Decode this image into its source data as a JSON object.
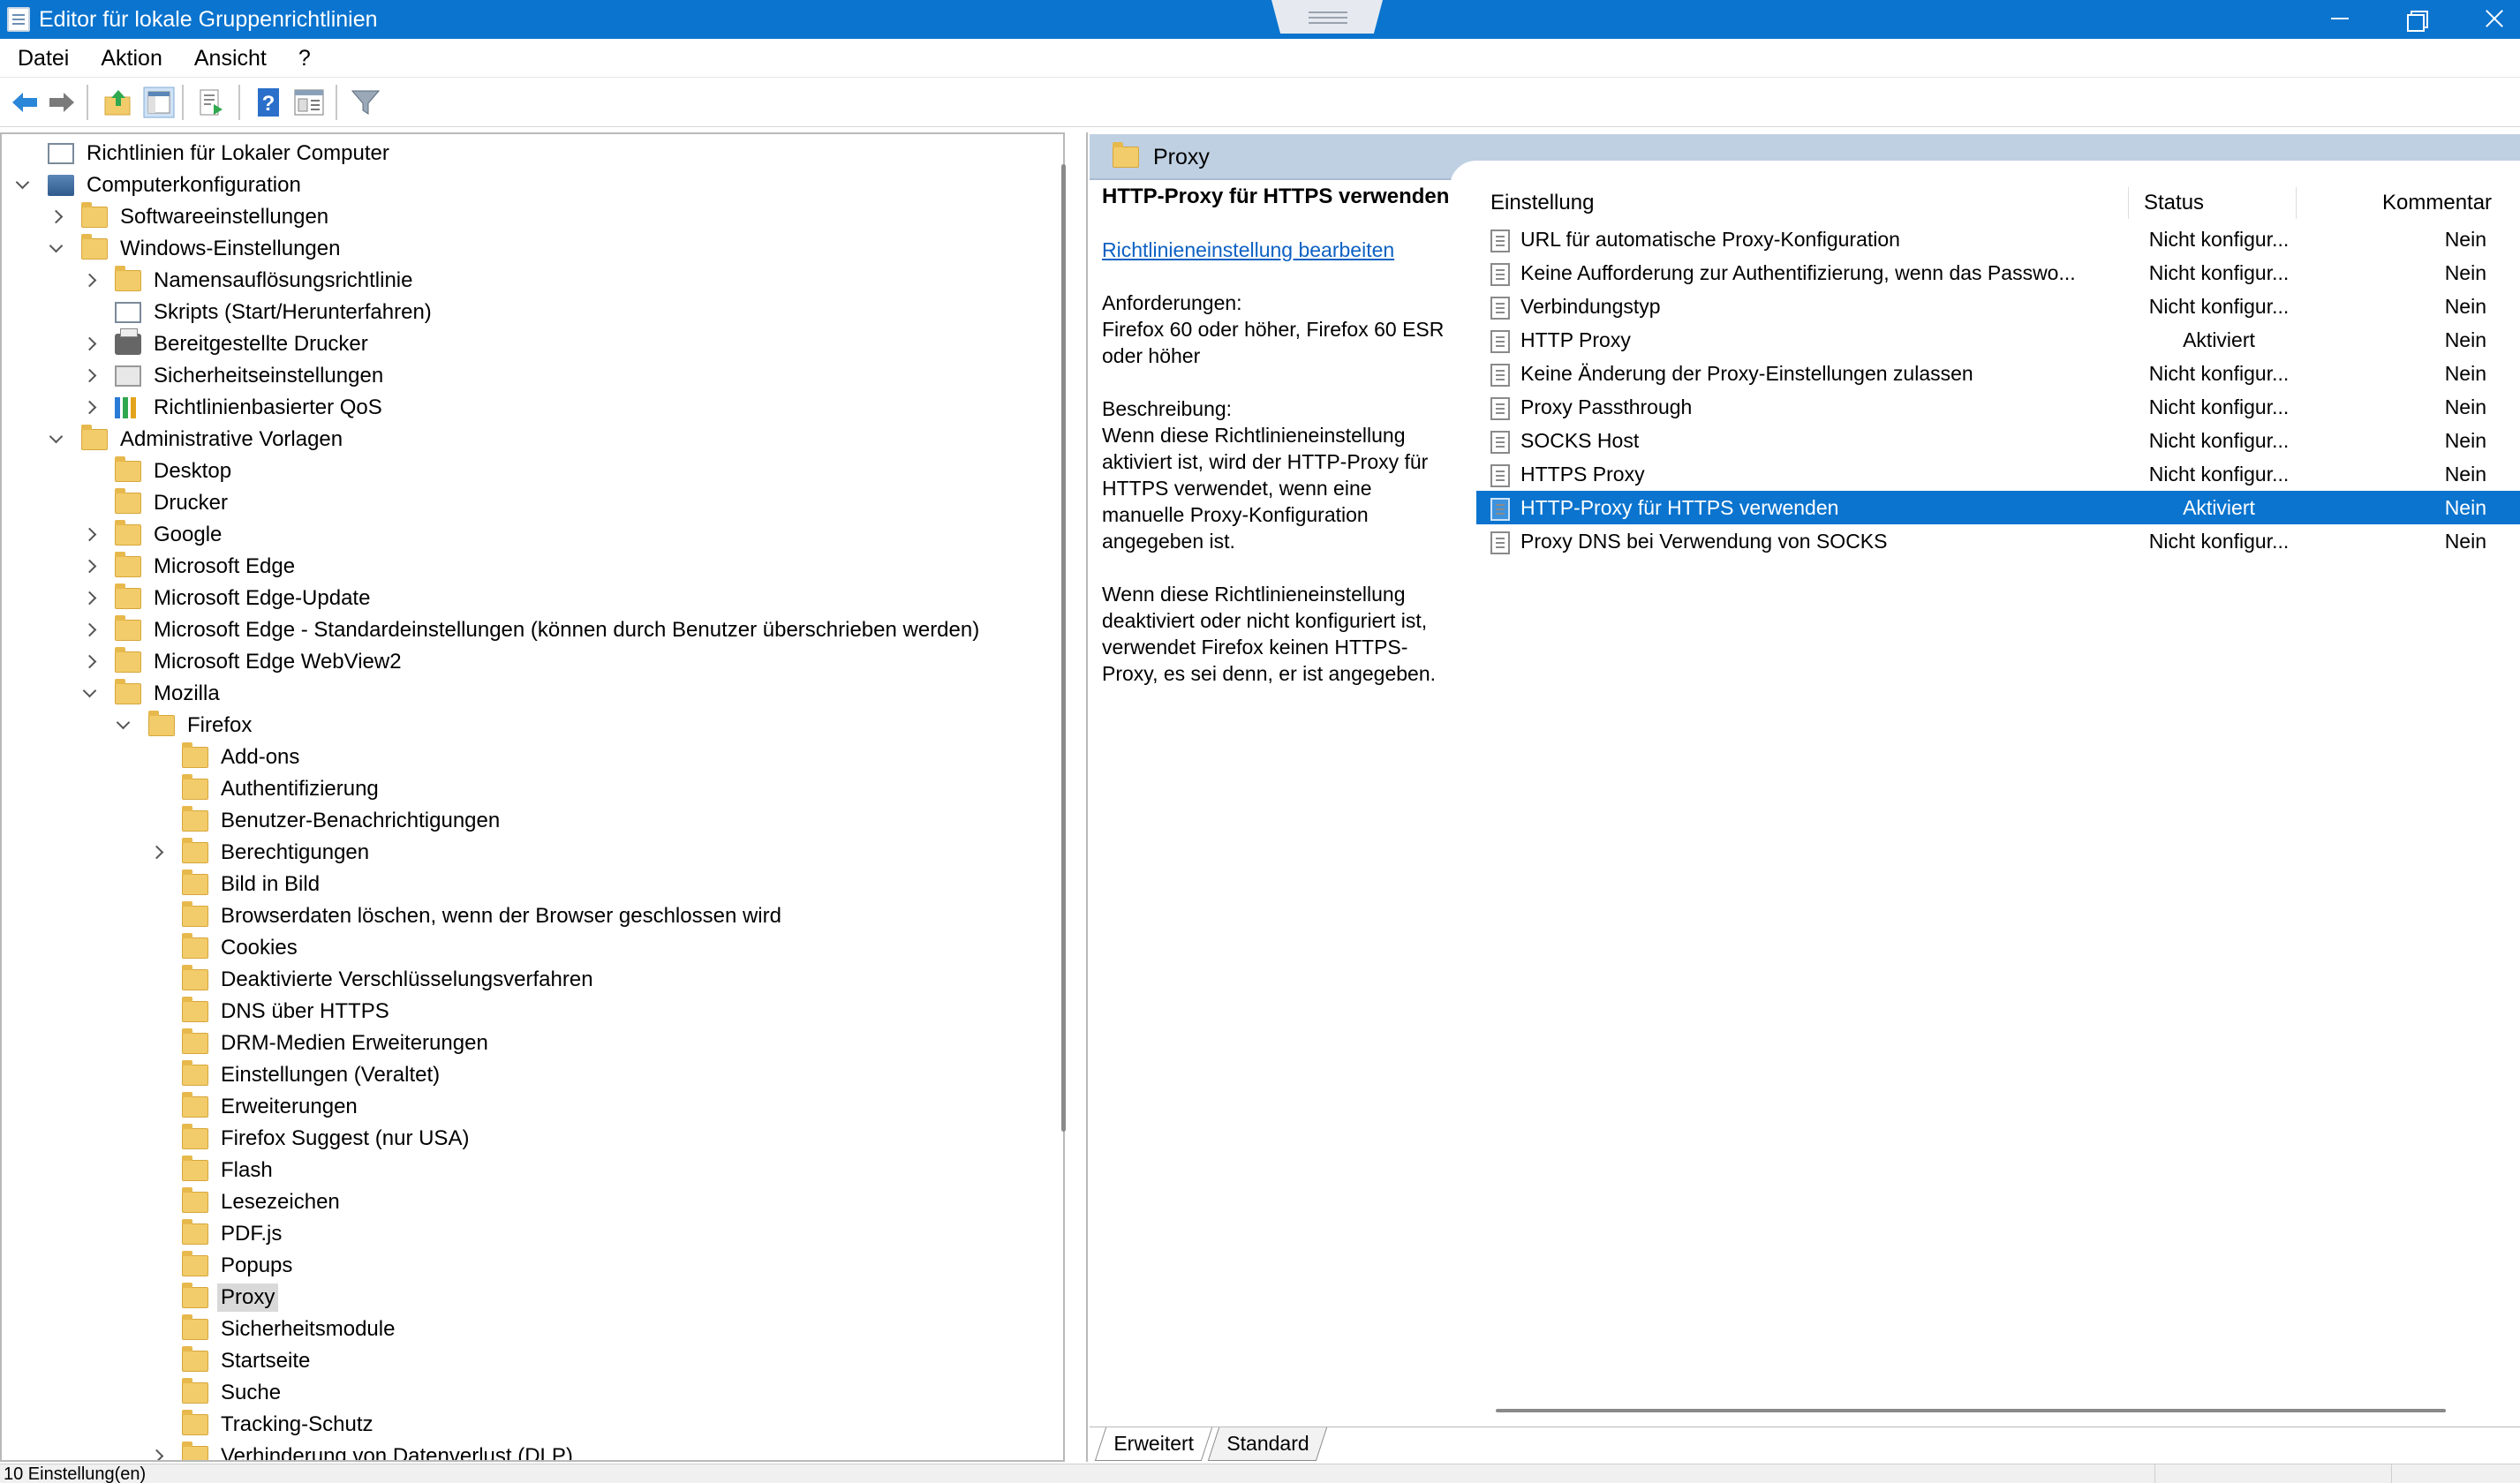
{
  "window": {
    "title": "Editor für lokale Gruppenrichtlinien"
  },
  "menu": [
    "Datei",
    "Aktion",
    "Ansicht",
    "?"
  ],
  "toolbar_icons": [
    "back-arrow-icon",
    "forward-arrow-icon",
    "up-folder-icon",
    "show-tree-icon",
    "export-list-icon",
    "help-icon",
    "properties-icon",
    "filter-icon"
  ],
  "tree": [
    {
      "label": "Richtlinien für Lokaler Computer",
      "level": 0,
      "chev": "none",
      "icon": "doc"
    },
    {
      "label": "Computerkonfiguration",
      "level": 0,
      "chev": "down",
      "icon": "computer"
    },
    {
      "label": "Softwareeinstellungen",
      "level": 1,
      "chev": "right",
      "icon": "folder"
    },
    {
      "label": "Windows-Einstellungen",
      "level": 1,
      "chev": "down",
      "icon": "folder"
    },
    {
      "label": "Namensauflösungsrichtlinie",
      "level": 2,
      "chev": "right",
      "icon": "folder"
    },
    {
      "label": "Skripts (Start/Herunterfahren)",
      "level": 2,
      "chev": "none",
      "icon": "doc"
    },
    {
      "label": "Bereitgestellte Drucker",
      "level": 2,
      "chev": "right",
      "icon": "printer"
    },
    {
      "label": "Sicherheitseinstellungen",
      "level": 2,
      "chev": "right",
      "icon": "shield"
    },
    {
      "label": "Richtlinienbasierter QoS",
      "level": 2,
      "chev": "right",
      "icon": "bars"
    },
    {
      "label": "Administrative Vorlagen",
      "level": 1,
      "chev": "down",
      "icon": "folder"
    },
    {
      "label": "Desktop",
      "level": 2,
      "chev": "none",
      "icon": "folder"
    },
    {
      "label": "Drucker",
      "level": 2,
      "chev": "none",
      "icon": "folder"
    },
    {
      "label": "Google",
      "level": 2,
      "chev": "right",
      "icon": "folder"
    },
    {
      "label": "Microsoft Edge",
      "level": 2,
      "chev": "right",
      "icon": "folder"
    },
    {
      "label": "Microsoft Edge-Update",
      "level": 2,
      "chev": "right",
      "icon": "folder"
    },
    {
      "label": "Microsoft Edge - Standardeinstellungen (können durch Benutzer überschrieben werden)",
      "level": 2,
      "chev": "right",
      "icon": "folder"
    },
    {
      "label": "Microsoft Edge WebView2",
      "level": 2,
      "chev": "right",
      "icon": "folder"
    },
    {
      "label": "Mozilla",
      "level": 2,
      "chev": "down",
      "icon": "folder"
    },
    {
      "label": "Firefox",
      "level": 3,
      "chev": "down",
      "icon": "folder"
    },
    {
      "label": "Add-ons",
      "level": 4,
      "chev": "none",
      "icon": "folder"
    },
    {
      "label": "Authentifizierung",
      "level": 4,
      "chev": "none",
      "icon": "folder"
    },
    {
      "label": "Benutzer-Benachrichtigungen",
      "level": 4,
      "chev": "none",
      "icon": "folder"
    },
    {
      "label": "Berechtigungen",
      "level": 4,
      "chev": "right",
      "icon": "folder"
    },
    {
      "label": "Bild in Bild",
      "level": 4,
      "chev": "none",
      "icon": "folder"
    },
    {
      "label": "Browserdaten löschen, wenn der Browser geschlossen wird",
      "level": 4,
      "chev": "none",
      "icon": "folder"
    },
    {
      "label": "Cookies",
      "level": 4,
      "chev": "none",
      "icon": "folder"
    },
    {
      "label": "Deaktivierte Verschlüsselungsverfahren",
      "level": 4,
      "chev": "none",
      "icon": "folder"
    },
    {
      "label": "DNS über HTTPS",
      "level": 4,
      "chev": "none",
      "icon": "folder"
    },
    {
      "label": "DRM-Medien Erweiterungen",
      "level": 4,
      "chev": "none",
      "icon": "folder"
    },
    {
      "label": "Einstellungen (Veraltet)",
      "level": 4,
      "chev": "none",
      "icon": "folder"
    },
    {
      "label": "Erweiterungen",
      "level": 4,
      "chev": "none",
      "icon": "folder"
    },
    {
      "label": "Firefox Suggest (nur USA)",
      "level": 4,
      "chev": "none",
      "icon": "folder"
    },
    {
      "label": "Flash",
      "level": 4,
      "chev": "none",
      "icon": "folder"
    },
    {
      "label": "Lesezeichen",
      "level": 4,
      "chev": "none",
      "icon": "folder"
    },
    {
      "label": "PDF.js",
      "level": 4,
      "chev": "none",
      "icon": "folder"
    },
    {
      "label": "Popups",
      "level": 4,
      "chev": "none",
      "icon": "folder"
    },
    {
      "label": "Proxy",
      "level": 4,
      "chev": "none",
      "icon": "folder",
      "selected": true
    },
    {
      "label": "Sicherheitsmodule",
      "level": 4,
      "chev": "none",
      "icon": "folder"
    },
    {
      "label": "Startseite",
      "level": 4,
      "chev": "none",
      "icon": "folder"
    },
    {
      "label": "Suche",
      "level": 4,
      "chev": "none",
      "icon": "folder"
    },
    {
      "label": "Tracking-Schutz",
      "level": 4,
      "chev": "none",
      "icon": "folder"
    },
    {
      "label": "Verhinderung von Datenverlust (DLP)",
      "level": 4,
      "chev": "right",
      "icon": "folder"
    }
  ],
  "right": {
    "header": "Proxy",
    "desc_title": "HTTP-Proxy für HTTPS verwenden",
    "desc_link": "Richtlinieneinstellung bearbeiten",
    "req_label": "Anforderungen:",
    "req_text": "Firefox 60 oder höher, Firefox 60 ESR oder höher",
    "desc_label": "Beschreibung:",
    "desc_text1": "Wenn diese Richtlinieneinstellung aktiviert ist, wird der HTTP-Proxy für HTTPS verwendet, wenn eine manuelle Proxy-Konfiguration angegeben ist.",
    "desc_text2": "Wenn diese Richtlinieneinstellung deaktiviert oder nicht konfiguriert ist, verwendet Firefox keinen HTTPS-Proxy, es sei denn, er ist angegeben.",
    "columns": {
      "setting": "Einstellung",
      "status": "Status",
      "comment": "Kommentar"
    },
    "rows": [
      {
        "setting": "URL für automatische Proxy-Konfiguration",
        "status": "Nicht konfigur...",
        "comment": "Nein"
      },
      {
        "setting": "Keine Aufforderung zur Authentifizierung, wenn das Passwo...",
        "status": "Nicht konfigur...",
        "comment": "Nein"
      },
      {
        "setting": "Verbindungstyp",
        "status": "Nicht konfigur...",
        "comment": "Nein"
      },
      {
        "setting": "HTTP Proxy",
        "status": "Aktiviert",
        "comment": "Nein"
      },
      {
        "setting": "Keine Änderung der Proxy-Einstellungen zulassen",
        "status": "Nicht konfigur...",
        "comment": "Nein"
      },
      {
        "setting": "Proxy Passthrough",
        "status": "Nicht konfigur...",
        "comment": "Nein"
      },
      {
        "setting": "SOCKS Host",
        "status": "Nicht konfigur...",
        "comment": "Nein"
      },
      {
        "setting": "HTTPS Proxy",
        "status": "Nicht konfigur...",
        "comment": "Nein"
      },
      {
        "setting": "HTTP-Proxy für HTTPS verwenden",
        "status": "Aktiviert",
        "comment": "Nein",
        "selected": true
      },
      {
        "setting": "Proxy DNS bei Verwendung von SOCKS",
        "status": "Nicht konfigur...",
        "comment": "Nein"
      }
    ],
    "tabs": [
      "Erweitert",
      "Standard"
    ]
  },
  "statusbar": {
    "text": "10 Einstellung(en)"
  },
  "colors": {
    "titlebar": "#0a74cf",
    "selection": "#0a74cf",
    "header_band": "#bfd0e3",
    "link": "#0b61c3",
    "folder": "#f2cc6a"
  }
}
